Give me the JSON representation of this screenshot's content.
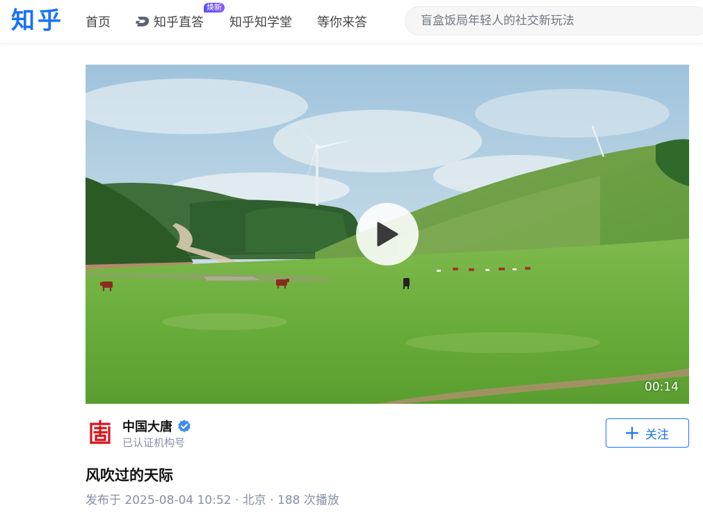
{
  "header": {
    "logo": "知乎",
    "nav": [
      {
        "label": "首页"
      },
      {
        "label": "知乎直答",
        "badge": "焕新",
        "icon": "zhida-icon"
      },
      {
        "label": "知乎知学堂"
      },
      {
        "label": "等你来答"
      }
    ],
    "search": {
      "placeholder": "盲盒饭局年轻人的社交新玩法",
      "icon": "search-icon"
    }
  },
  "video": {
    "duration": "00:14",
    "play_icon": "play-icon",
    "scene": "grassland-wind-turbines"
  },
  "author": {
    "name": "中国大唐",
    "verified": true,
    "subtitle": "已认证机构号",
    "avatar_icon": "datang-logo-icon"
  },
  "follow_button": {
    "label": "关注",
    "icon": "plus-icon"
  },
  "post": {
    "title": "风吹过的天际",
    "meta": "发布于 2025-08-04 10:52 · 北京 · 188 次播放"
  },
  "colors": {
    "brand": "#1772f6",
    "badge": "#6c4dff",
    "secondary_text": "#8590a6",
    "verified": "#3d8bf2"
  }
}
